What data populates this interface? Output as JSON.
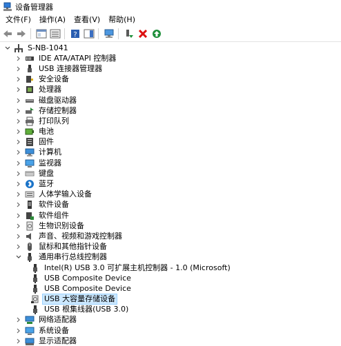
{
  "window": {
    "title": "设备管理器"
  },
  "menu": [
    "文件(F)",
    "操作(A)",
    "查看(V)",
    "帮助(H)"
  ],
  "tree": {
    "root": "S-NB-1041",
    "categories": [
      {
        "label": "IDE ATA/ATAPI 控制器",
        "icon": "ide-controller-icon"
      },
      {
        "label": "USB 连接器管理器",
        "icon": "usb-connector-icon"
      },
      {
        "label": "安全设备",
        "icon": "security-device-icon"
      },
      {
        "label": "处理器",
        "icon": "processor-icon"
      },
      {
        "label": "磁盘驱动器",
        "icon": "disk-drive-icon"
      },
      {
        "label": "存储控制器",
        "icon": "storage-controller-icon"
      },
      {
        "label": "打印队列",
        "icon": "printer-icon"
      },
      {
        "label": "电池",
        "icon": "battery-icon"
      },
      {
        "label": "固件",
        "icon": "firmware-icon"
      },
      {
        "label": "计算机",
        "icon": "computer-icon"
      },
      {
        "label": "监视器",
        "icon": "monitor-icon"
      },
      {
        "label": "键盘",
        "icon": "keyboard-icon"
      },
      {
        "label": "蓝牙",
        "icon": "bluetooth-icon"
      },
      {
        "label": "人体学输入设备",
        "icon": "hid-icon"
      },
      {
        "label": "软件设备",
        "icon": "software-device-icon"
      },
      {
        "label": "软件组件",
        "icon": "software-component-icon"
      },
      {
        "label": "生物识别设备",
        "icon": "biometric-icon"
      },
      {
        "label": "声音、视频和游戏控制器",
        "icon": "sound-icon"
      },
      {
        "label": "鼠标和其他指针设备",
        "icon": "mouse-icon"
      }
    ],
    "usb_category": {
      "label": "通用串行总线控制器",
      "children": [
        "Intel(R) USB 3.0 可扩展主机控制器 - 1.0 (Microsoft)",
        "USB Composite Device",
        "USB Composite Device",
        "USB 大容量存储设备",
        "USB 根集线器(USB 3.0)"
      ],
      "selected_index": 3
    },
    "after": [
      {
        "label": "网络适配器",
        "icon": "network-adapter-icon"
      },
      {
        "label": "系统设备",
        "icon": "system-device-icon"
      },
      {
        "label": "显示适配器",
        "icon": "display-adapter-icon"
      }
    ]
  },
  "colors": {
    "selection": "#cce8ff",
    "selection_border": "#99d1ff",
    "green": "#1e8f3a",
    "red": "#d11",
    "blue": "#1a73c8"
  }
}
